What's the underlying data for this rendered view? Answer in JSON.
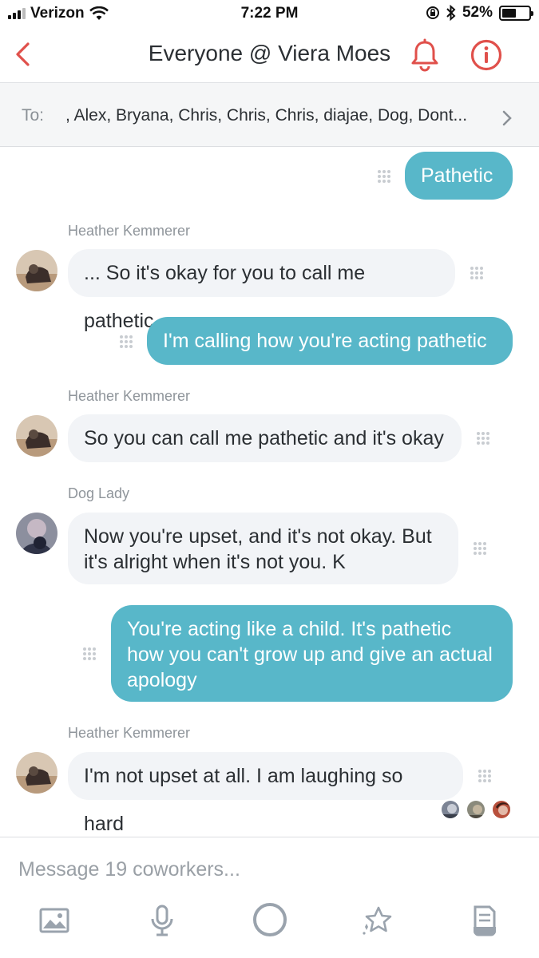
{
  "status_bar": {
    "carrier": "Verizon",
    "time": "7:22 PM",
    "battery_percent": "52%",
    "battery_level": 0.52
  },
  "header": {
    "title": "Everyone @ Viera Moes",
    "accent_color": "#e0504b"
  },
  "recipients": {
    "label": "To:",
    "names": ", Alex, Bryana, Chris, Chris, Chris, diajae, Dog, Dont..."
  },
  "messages": [
    {
      "direction": "out",
      "text": "Pathetic"
    },
    {
      "direction": "in",
      "sender": "Heather Kemmerer",
      "text": "... So it's okay for you to call me pathetic"
    },
    {
      "direction": "out",
      "text": "I'm calling how you're acting pathetic"
    },
    {
      "direction": "in",
      "sender": "Heather Kemmerer",
      "text": "So you can call me pathetic  and it's okay"
    },
    {
      "direction": "in",
      "sender": "Dog Lady",
      "text_lines": [
        "Now you're upset, and it's not okay. But",
        "it's alright when it's not you. K"
      ]
    },
    {
      "direction": "out",
      "text_lines": [
        "You're acting like a child. It's pathetic",
        "how you can't grow up and give an actual",
        "apology"
      ]
    },
    {
      "direction": "in",
      "sender": "Heather Kemmerer",
      "text": "I'm not upset at all. I am laughing so hard"
    }
  ],
  "composer": {
    "placeholder": "Message 19 coworkers..."
  },
  "toolbar": {
    "icons": [
      "image-icon",
      "microphone-icon",
      "circle-button-icon",
      "star-sparkle-icon",
      "document-icon"
    ]
  },
  "colors": {
    "outgoing_bubble": "#58b7c9",
    "incoming_bubble": "#f2f4f7",
    "icon_gray": "#9aa3ad"
  }
}
